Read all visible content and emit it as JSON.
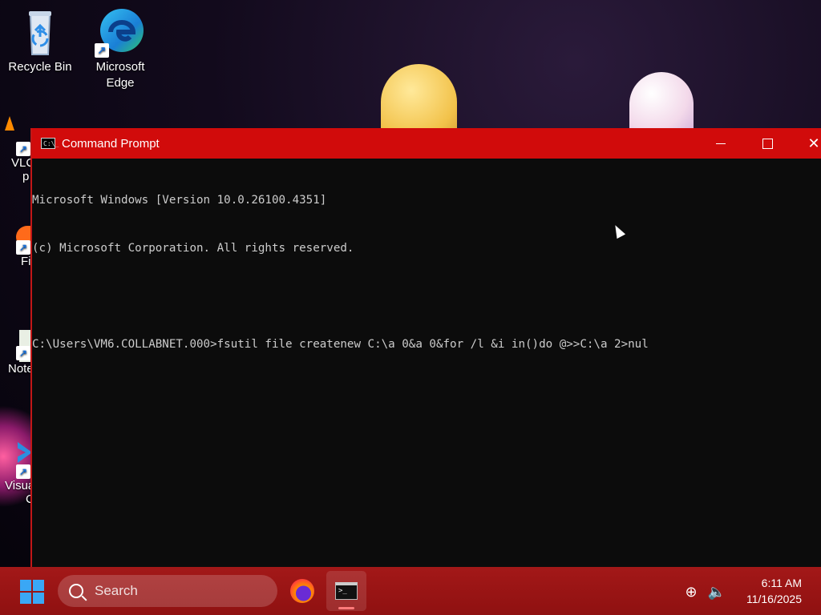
{
  "desktop": {
    "icons": [
      {
        "label_line1": "Recycle Bin",
        "label_line2": ""
      },
      {
        "label_line1": "Microsoft",
        "label_line2": "Edge"
      }
    ],
    "partial_icons": [
      {
        "label_line1": "VLC",
        "label_line2": "p"
      },
      {
        "label_line1": "Fi",
        "label_line2": ""
      },
      {
        "label_line1": "Note",
        "label_line2": ""
      },
      {
        "label_line1": "Visua",
        "label_line2": "C"
      }
    ]
  },
  "window": {
    "title": "Command Prompt",
    "icon_text": "C:\\_",
    "console_lines": [
      "Microsoft Windows [Version 10.0.26100.4351]",
      "(c) Microsoft Corporation. All rights reserved.",
      "",
      "C:\\Users\\VM6.COLLABNET.000>fsutil file createnew C:\\a 0&a 0&for /l &i in()do @>>C:\\a 2>nul"
    ],
    "close_glyph": "✕"
  },
  "taskbar": {
    "search_placeholder": "Search",
    "cmd_glyph": ">_",
    "time": "6:11 AM",
    "date": "11/16/2025",
    "globe_glyph": "⊕",
    "speaker_glyph": "🔈"
  }
}
